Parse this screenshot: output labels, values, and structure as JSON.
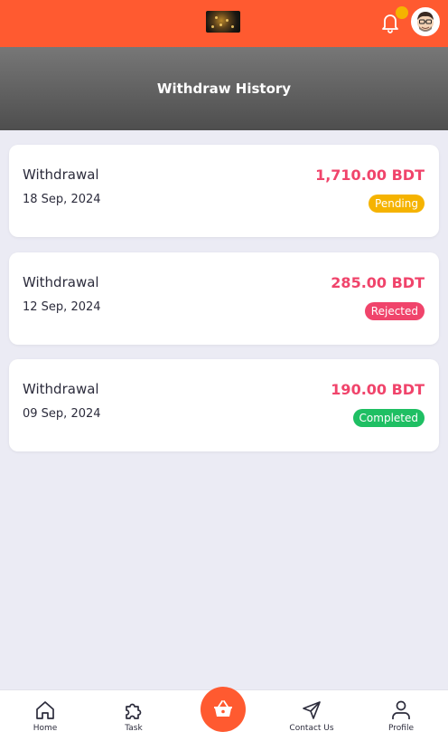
{
  "header": {
    "logo": "app-logo",
    "notification_icon": "bell-icon",
    "avatar": "user-avatar"
  },
  "page": {
    "title": "Withdraw History"
  },
  "withdrawals": [
    {
      "label": "Withdrawal",
      "date": "18 Sep, 2024",
      "amount": "1,710.00 BDT",
      "status": "Pending",
      "status_color": "#f5b300"
    },
    {
      "label": "Withdrawal",
      "date": "12 Sep, 2024",
      "amount": "285.00 BDT",
      "status": "Rejected",
      "status_color": "#f0446b"
    },
    {
      "label": "Withdrawal",
      "date": "09 Sep, 2024",
      "amount": "190.00 BDT",
      "status": "Completed",
      "status_color": "#1fbf63"
    }
  ],
  "nav": {
    "home": "Home",
    "task": "Task",
    "cart": "basket-icon",
    "contact": "Contact Us",
    "profile": "Profile"
  },
  "colors": {
    "brand": "#ff5a30",
    "amount": "#f0446b",
    "background": "#ebebf4"
  }
}
